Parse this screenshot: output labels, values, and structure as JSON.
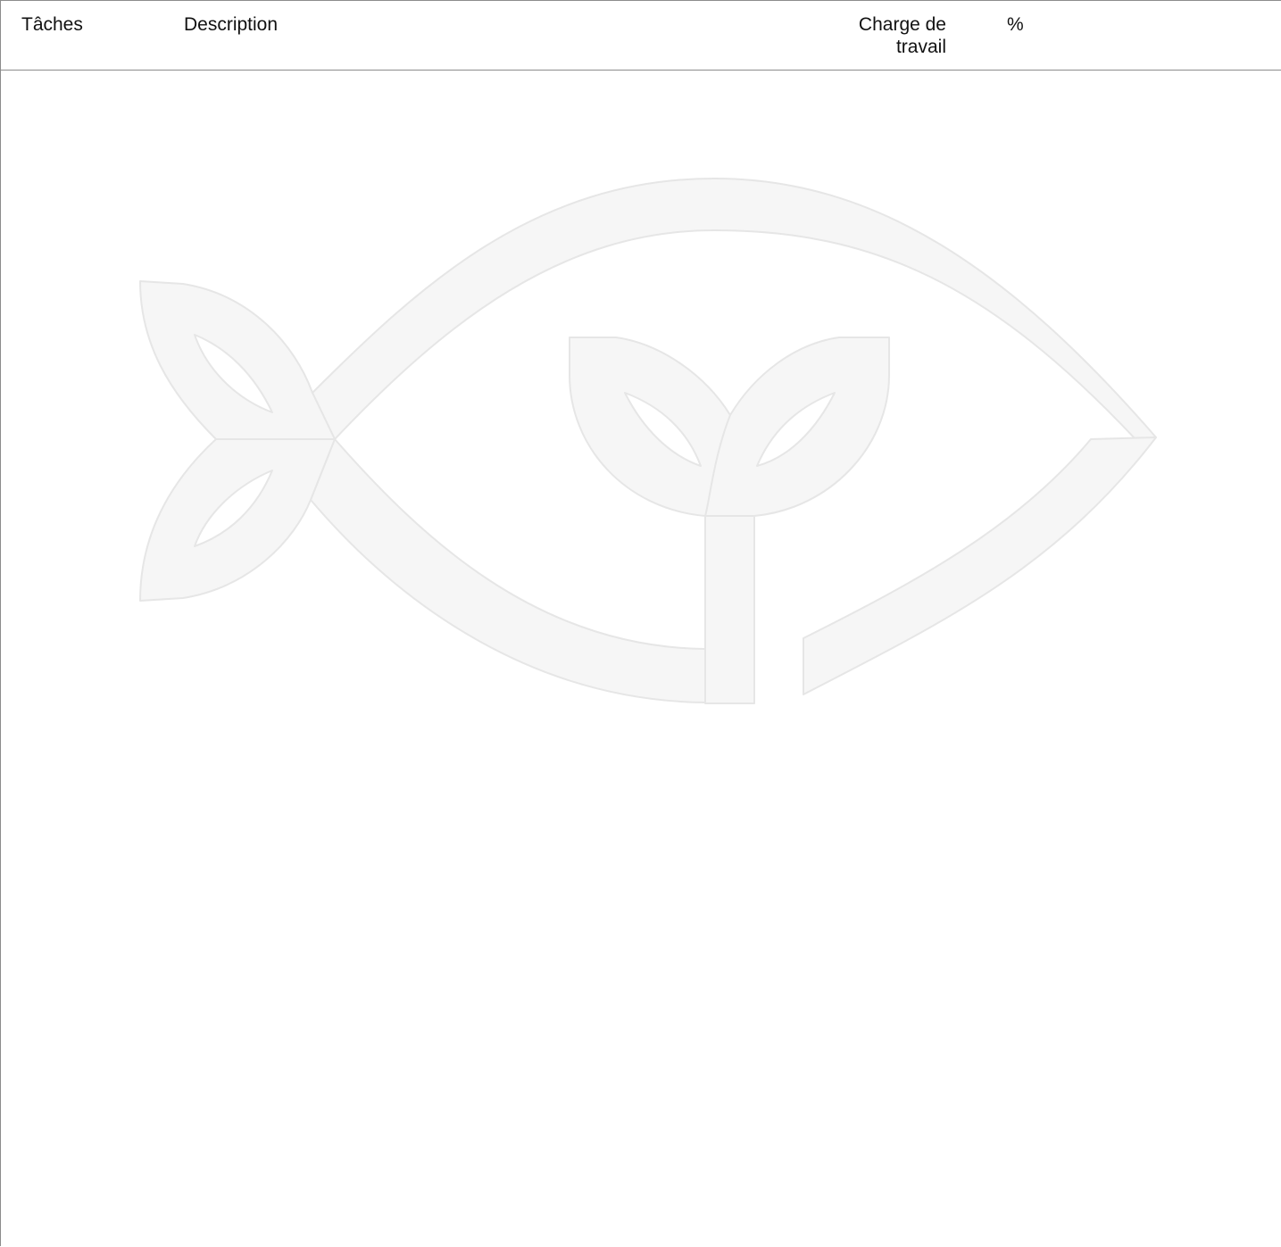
{
  "table": {
    "columns": [
      {
        "label": "Tâches"
      },
      {
        "label": "Description"
      },
      {
        "label": "Charge de\ntravail"
      },
      {
        "label": "%"
      }
    ]
  },
  "watermark": {
    "icon": "fish-sprout-logo-icon",
    "fill_color": "#f6f6f6",
    "stroke_color": "#e6e6e6"
  }
}
